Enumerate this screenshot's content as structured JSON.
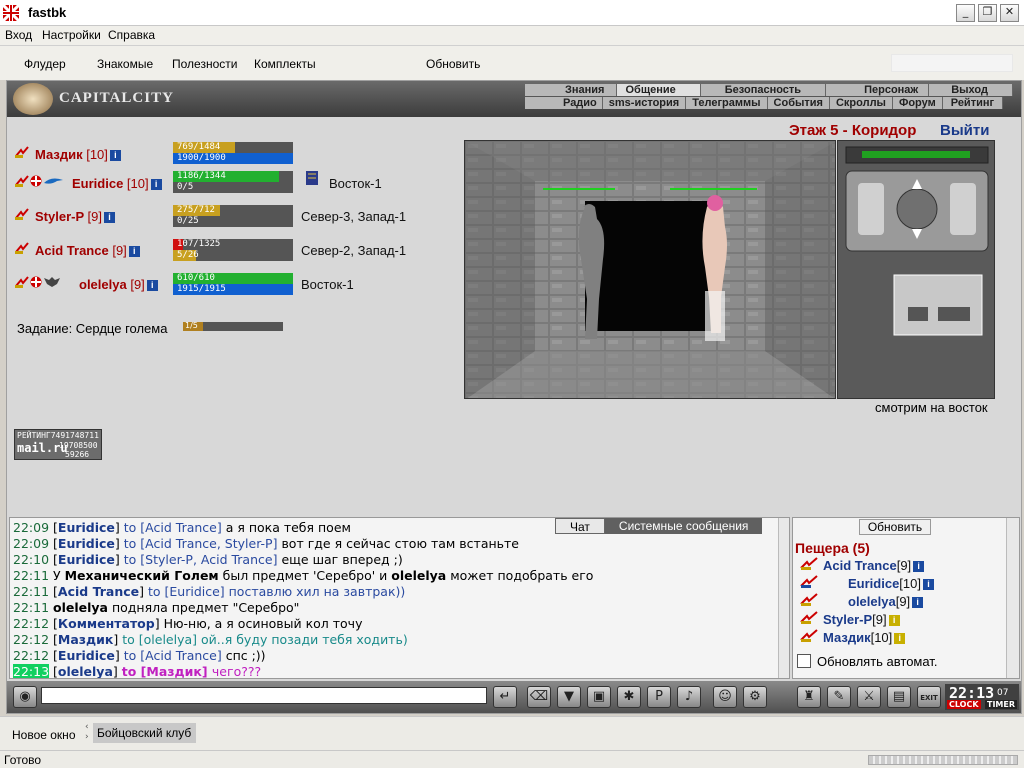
{
  "window": {
    "title": "fastbk",
    "minimize": "_",
    "maximize": "❐",
    "close": "✕"
  },
  "menu": [
    "Вход",
    "Настройки",
    "Справка"
  ],
  "toolbar": {
    "items": [
      "Флудер",
      "Знакомые",
      "Полезности",
      "Комплекты"
    ],
    "refresh": "Обновить"
  },
  "game": {
    "brand": "CAPITALCITY",
    "nav_top": [
      "Знания",
      "Общение",
      "Безопасность",
      "Персонаж",
      "Выход"
    ],
    "nav_bottom": [
      "Радио",
      "sms-история",
      "Телеграммы",
      "События",
      "Скроллы",
      "Форум",
      "Рейтинг"
    ],
    "location": "Этаж 5 - Коридор",
    "exit": "Выйти",
    "looking": "смотрим на восток",
    "task_label": "Задание: Сердце голема",
    "task_progress": "1/5",
    "team": [
      {
        "name": "Маздик",
        "level": "[10]",
        "hp": "769/1484",
        "mana": "1900/1900",
        "location": ""
      },
      {
        "name": "Euridice",
        "level": "[10]",
        "hp": "1186/1344",
        "mana": "0/5",
        "location": "Восток-1"
      },
      {
        "name": "Styler-P",
        "level": "[9]",
        "hp": "275/712",
        "mana": "0/25",
        "location": "Север-3, Запад-1"
      },
      {
        "name": "Acid Trance",
        "level": "[9]",
        "hp": "107/1325",
        "mana": "5/26",
        "location": "Север-2, Запад-1"
      },
      {
        "name": "olelelya",
        "level": "[9]",
        "hp": "610/610",
        "mana": "1915/1915",
        "location": "Восток-1"
      }
    ],
    "counter": {
      "label": "РЕЙТИНГ",
      "value1": "7491748711",
      "brand": "mail.ru",
      "value2": "19708500",
      "value3": "59266"
    }
  },
  "chat": {
    "tab_chat": "Чат",
    "tab_system": "Системные сообщения",
    "lines": [
      {
        "time": "22:09",
        "parts": [
          [
            "[",
            ""
          ],
          [
            "Euridice",
            "nm"
          ],
          [
            "] ",
            ""
          ],
          [
            "to [Acid Trance] ",
            "tgt"
          ],
          [
            "а я пока тебя поем",
            ""
          ]
        ]
      },
      {
        "time": "22:09",
        "parts": [
          [
            "[",
            ""
          ],
          [
            "Euridice",
            "nm"
          ],
          [
            "] ",
            ""
          ],
          [
            "to [Acid Trance, Styler-P] ",
            "tgt"
          ],
          [
            "вот где я сейчас стою там встаньте",
            ""
          ]
        ]
      },
      {
        "time": "22:10",
        "parts": [
          [
            "[",
            ""
          ],
          [
            "Euridice",
            "nm"
          ],
          [
            "] ",
            ""
          ],
          [
            "to [Styler-P, Acid Trance] ",
            "tgt"
          ],
          [
            "еще шаг вперед ;)",
            ""
          ]
        ]
      },
      {
        "time": "22:11",
        "parts": [
          [
            "У ",
            ""
          ],
          [
            "Механический Голем",
            "bold"
          ],
          [
            " был предмет 'Серебро' и ",
            ""
          ],
          [
            "olelelya",
            "bold"
          ],
          [
            " может подобрать его",
            ""
          ]
        ]
      },
      {
        "time": "22:11",
        "parts": [
          [
            "[",
            ""
          ],
          [
            "Acid Trance",
            "nm"
          ],
          [
            "] ",
            ""
          ],
          [
            "to [Euridice] поставлю хил на завтрак))",
            "tgt"
          ]
        ]
      },
      {
        "time": "22:11",
        "parts": [
          [
            "olelelya",
            "bold"
          ],
          [
            " подняла предмет \"Серебро\"",
            ""
          ]
        ]
      },
      {
        "time": "22:12",
        "parts": [
          [
            "[",
            ""
          ],
          [
            "Комментатор",
            "nm"
          ],
          [
            "] ",
            ""
          ],
          [
            "Ню-ню, а я осиновый кол точу",
            ""
          ]
        ]
      },
      {
        "time": "22:12",
        "parts": [
          [
            "[",
            ""
          ],
          [
            "Маздик",
            "nm"
          ],
          [
            "] ",
            ""
          ],
          [
            "to [olelelya] ой..я буду позади тебя ходить)",
            "tgt-teal"
          ]
        ]
      },
      {
        "time": "22:12",
        "parts": [
          [
            "[",
            ""
          ],
          [
            "Euridice",
            "nm"
          ],
          [
            "] ",
            ""
          ],
          [
            "to [Acid Trance] ",
            "tgt"
          ],
          [
            "спс ;))",
            ""
          ]
        ]
      },
      {
        "time": "22:13",
        "highlight": true,
        "parts": [
          [
            "[",
            ""
          ],
          [
            "olelelya",
            "nm"
          ],
          [
            "] ",
            ""
          ],
          [
            "to [Маздик] ",
            "tgt-mag"
          ],
          [
            "чего???",
            "tgt-magn"
          ]
        ]
      }
    ]
  },
  "room": {
    "refresh": "Обновить",
    "title": "Пещера (5)",
    "members": [
      {
        "name": "Acid Trance",
        "level": "[9]"
      },
      {
        "name": "Euridice",
        "level": "[10]"
      },
      {
        "name": "olelelya",
        "level": "[9]"
      },
      {
        "name": "Styler-P",
        "level": "[9]"
      },
      {
        "name": "Маздик",
        "level": "[10]"
      }
    ],
    "auto_refresh": "Обновлять автомат."
  },
  "clock": {
    "time": "22:13",
    "seconds": "07",
    "clock_label": "CLOCK",
    "timer_label": "TIMER",
    "exit_label": "EXIT"
  },
  "tabs": {
    "new_window": "Новое окно",
    "current": "Бойцовский клуб"
  },
  "status": "Готово",
  "colors": {
    "hp": "#22b030",
    "mana": "#1060d0",
    "hp_low": "#c8a020",
    "hp_crit": "#d01010",
    "name_red": "#a00000",
    "name_blue": "#1a3a8a"
  }
}
